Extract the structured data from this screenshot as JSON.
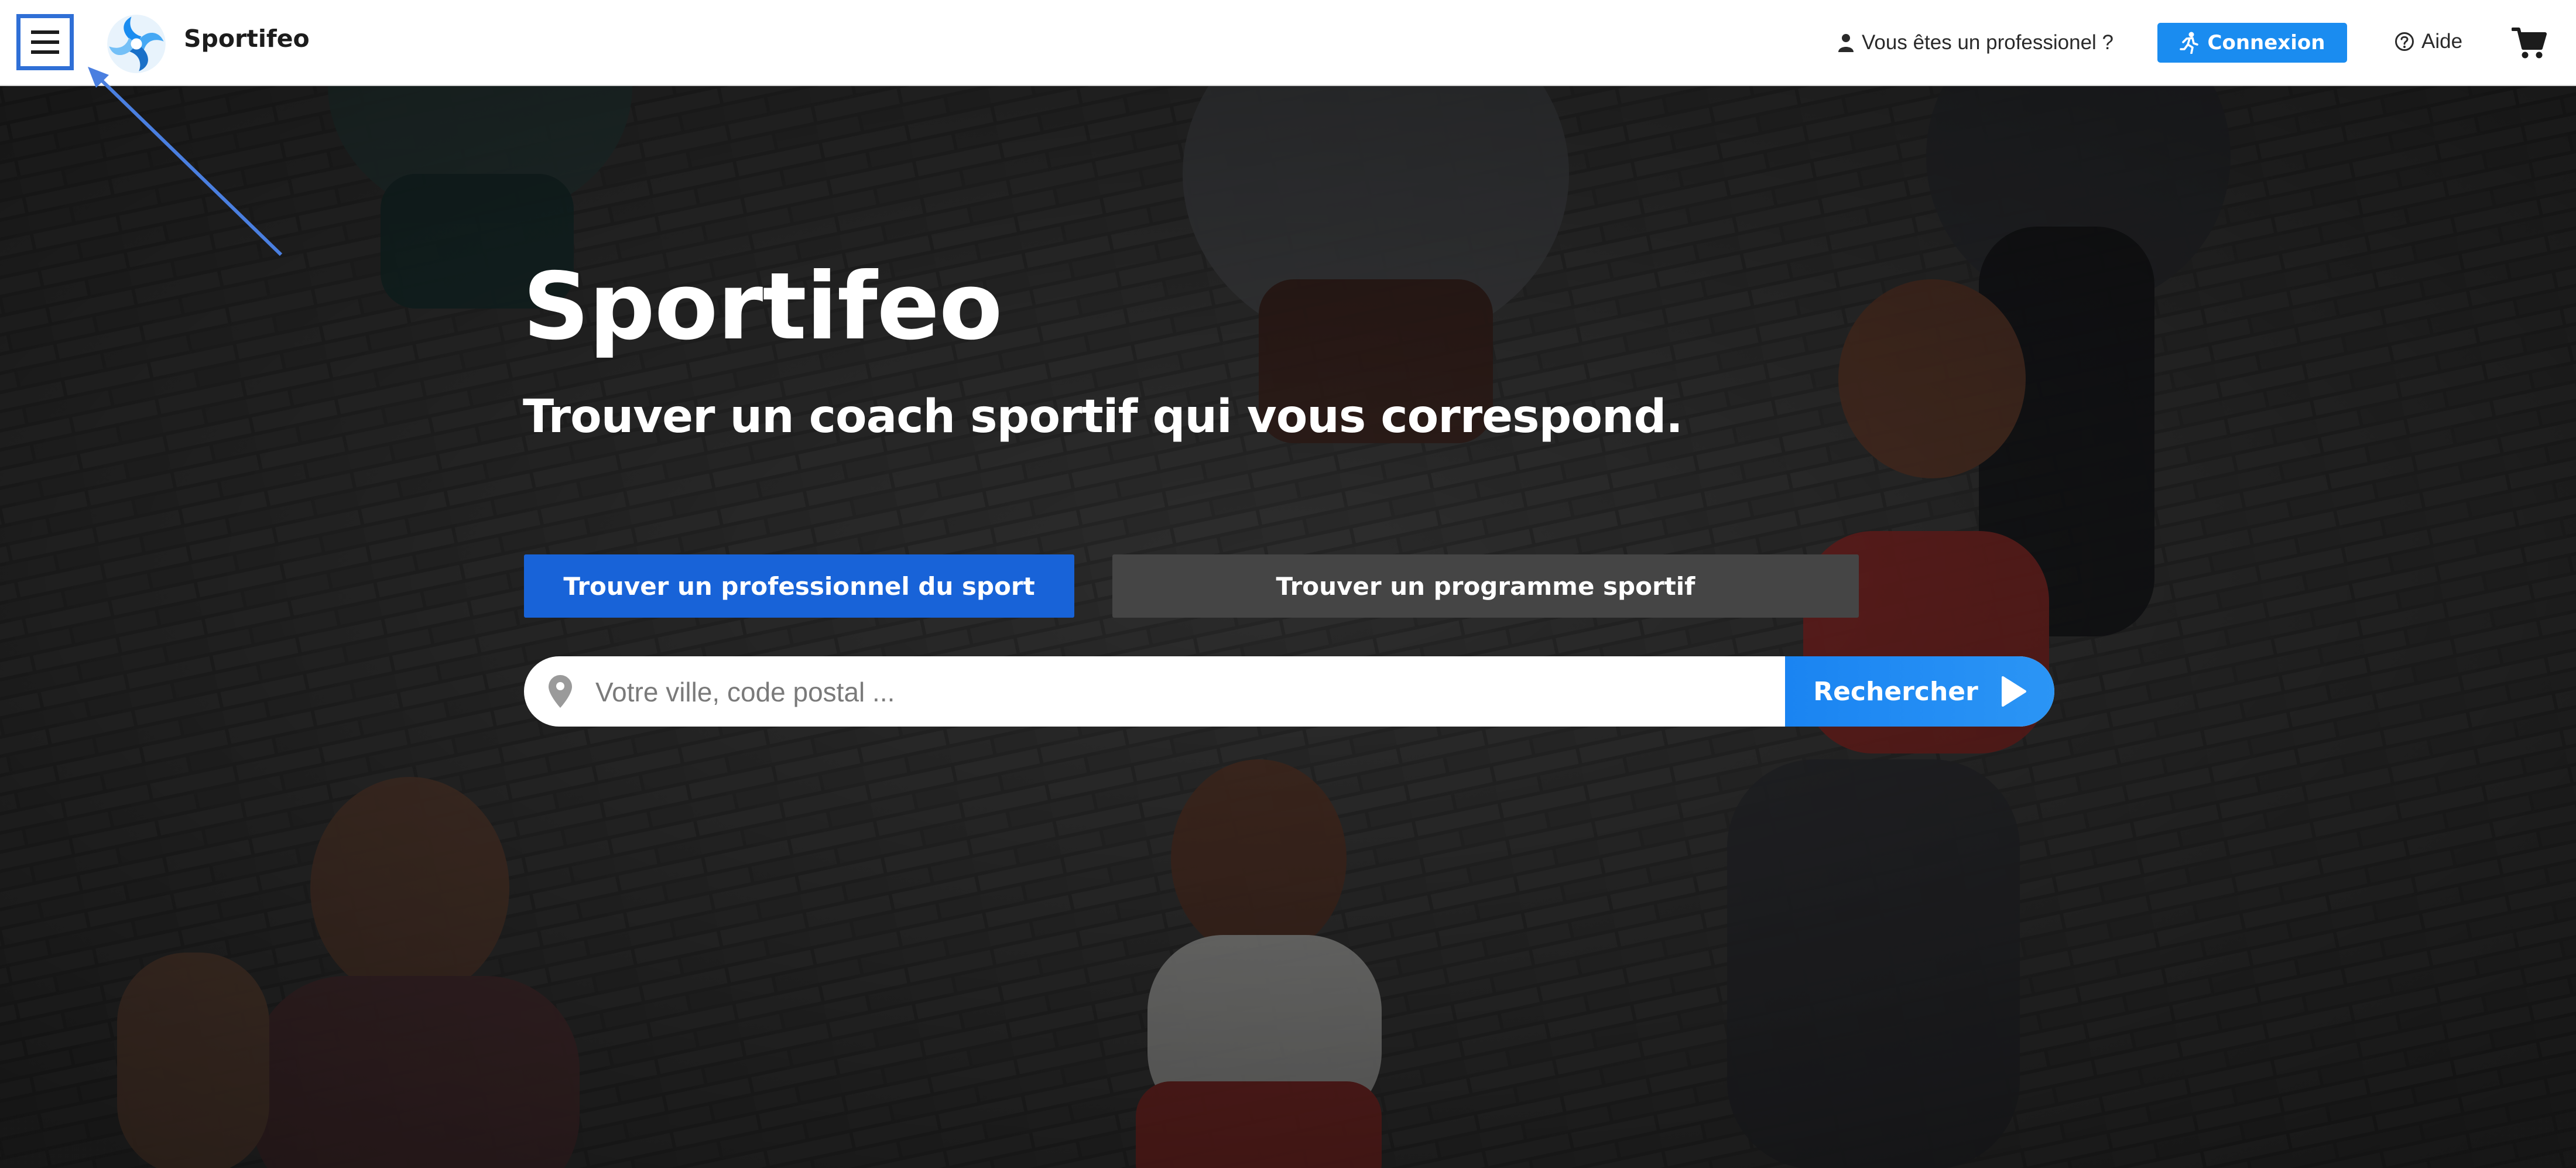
{
  "header": {
    "brand": "Sportifeo",
    "pro_link": "Vous êtes un professionel ?",
    "login_label": "Connexion",
    "help_label": "Aide"
  },
  "hero": {
    "title": "Sportifeo",
    "subtitle": "Trouver un coach sportif qui vous correspond.",
    "tabs": [
      {
        "label": "Trouver un professionnel du sport",
        "active": true
      },
      {
        "label": "Trouver un programme sportif",
        "active": false
      }
    ],
    "search": {
      "placeholder": "Votre ville, code postal ...",
      "button_label": "Rechercher"
    }
  },
  "icons": {
    "menu": "hamburger-menu-icon",
    "logo": "sportifeo-logo-icon",
    "pro": "user-icon",
    "login": "runner-icon",
    "help": "question-circle-icon",
    "cart": "shopping-cart-icon",
    "pin": "map-pin-icon",
    "search_arrow": "play-triangle-icon"
  },
  "colors": {
    "accent_blue": "#1a8cf0",
    "tab_active": "#1863d8",
    "tab_inactive": "#454545",
    "menu_highlight": "#2f6fd6"
  }
}
